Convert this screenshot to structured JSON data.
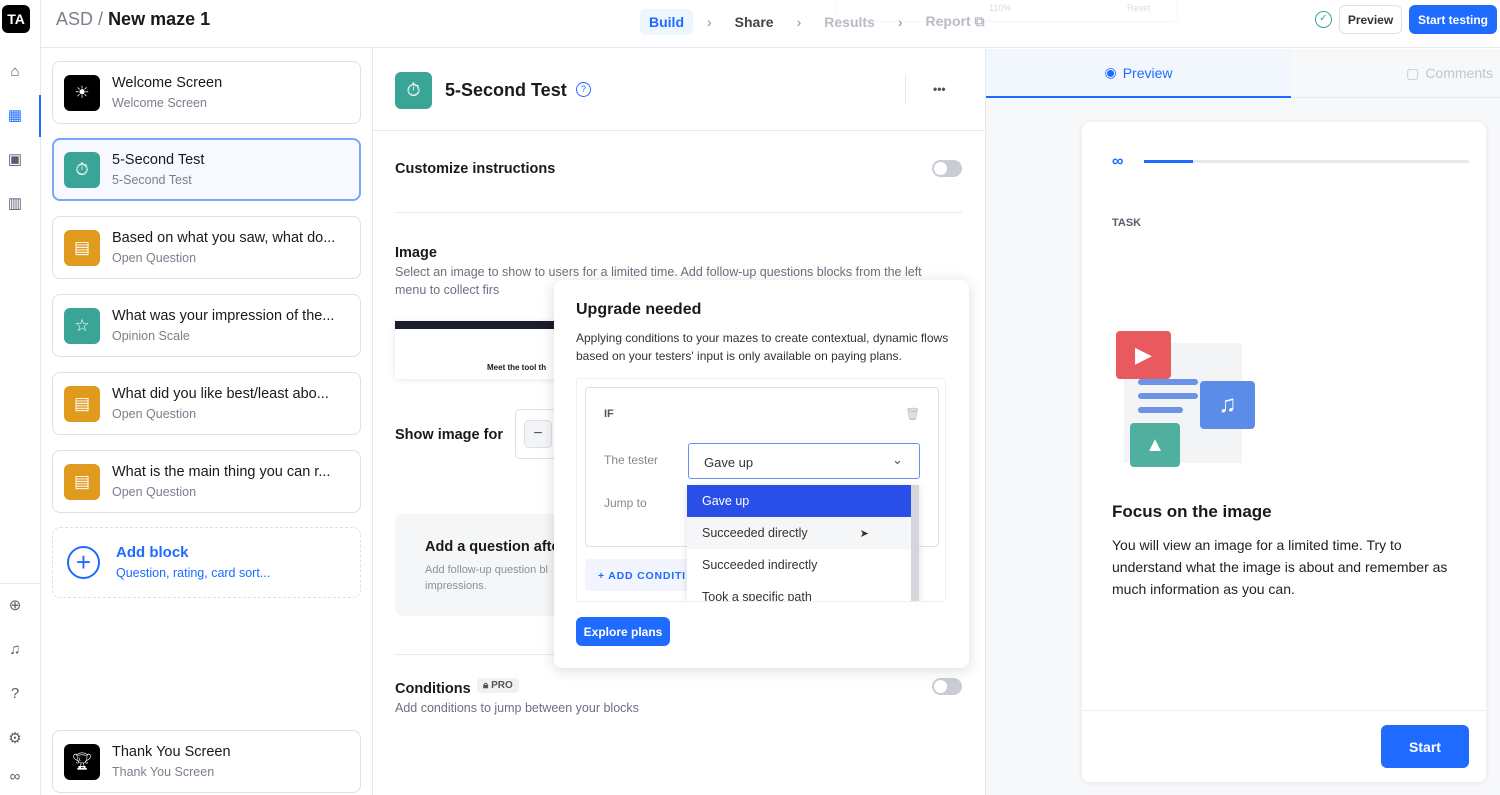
{
  "rail": {
    "avatar": "TA",
    "icons": [
      "home-icon",
      "blocks-icon",
      "contacts-icon",
      "chart-icon",
      "upload-icon",
      "bell-icon",
      "help-icon",
      "settings-icon",
      "maze-logo-icon"
    ]
  },
  "header": {
    "workspace": "ASD",
    "separator": "/",
    "title": "New maze 1",
    "steps": [
      {
        "label": "Build"
      },
      {
        "label": "Share"
      },
      {
        "label": "Results"
      },
      {
        "label": "Report"
      }
    ],
    "zoom_ghost": {
      "value": "110%",
      "reset": "Reset"
    },
    "preview_label": "Preview",
    "start_label": "Start testing"
  },
  "blocks": [
    {
      "title": "Welcome Screen",
      "subtitle": "Welcome Screen",
      "color": "#000000",
      "icon": "sun-icon"
    },
    {
      "title": "5-Second Test",
      "subtitle": "5-Second Test",
      "color": "#3aa597",
      "icon": "stopwatch-icon"
    },
    {
      "title": "Based on what you saw, what do...",
      "subtitle": "Open Question",
      "color": "#e09a1d",
      "icon": "chat-icon"
    },
    {
      "title": "What was your impression of the...",
      "subtitle": "Opinion Scale",
      "color": "#3aa597",
      "icon": "star-icon"
    },
    {
      "title": "What did you like best/least abo...",
      "subtitle": "Open Question",
      "color": "#e09a1d",
      "icon": "chat-icon"
    },
    {
      "title": "What is the main thing you can r...",
      "subtitle": "Open Question",
      "color": "#e09a1d",
      "icon": "chat-icon"
    }
  ],
  "add_block": {
    "title": "Add block",
    "subtitle": "Question, rating, card sort..."
  },
  "thank_you": {
    "title": "Thank You Screen",
    "subtitle": "Thank You Screen"
  },
  "editor": {
    "title": "5-Second Test",
    "more": "•••",
    "customize": "Customize instructions",
    "image_title": "Image",
    "image_desc": "Select an image to show to users for a limited time. Add follow-up questions blocks from the left menu to collect firs",
    "thumb_small": "Meet the tool th",
    "show_image_for": "Show image for",
    "minus": "−",
    "add_q_title": "Add a question afte",
    "add_q_desc": "Add follow-up question bl",
    "add_q_desc2": "impressions.",
    "conditions": "Conditions",
    "pro": "PRO",
    "conditions_desc": "Add conditions to jump between your blocks"
  },
  "popup": {
    "title": "Upgrade needed",
    "desc": "Applying conditions to your mazes to create contextual, dynamic flows based on your testers' input is only available on paying plans.",
    "if": "IF",
    "tester_label": "The tester",
    "selected": "Gave up",
    "jump_label": "Jump to",
    "options": [
      "Gave up",
      "Succeeded directly",
      "Succeeded indirectly",
      "Took a specific path"
    ],
    "add_condition": "+ ADD CONDITI",
    "explore": "Explore plans"
  },
  "preview": {
    "tab_preview": "Preview",
    "tab_comments": "Comments",
    "progress": 0.15,
    "task": "TASK",
    "heading": "Focus on the image",
    "body": "You will view an image for a limited time. Try to understand what the image is about and remember as much information as you can.",
    "start": "Start"
  }
}
